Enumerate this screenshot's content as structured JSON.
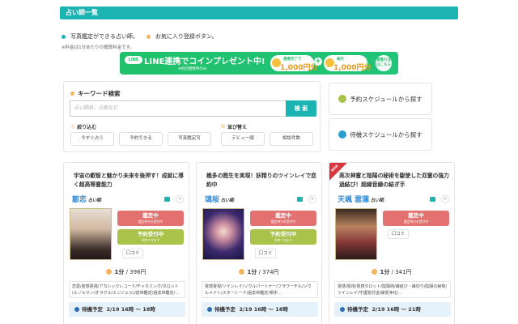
{
  "page": {
    "title": "占い師一覧"
  },
  "legend": {
    "photo_text": "写真鑑定ができる占い師。",
    "fav_text": "お気に入り登録ボタン。",
    "note": "※料金は1分あたりの概算料金です。",
    "colors": {
      "photo_dot": "#1cb3b3",
      "fav_dot": "#f4b35d"
    }
  },
  "line_banner": {
    "badge": "LINE",
    "main": "LINE連携でコインプレゼント中!",
    "sub": "※初回連携時のみ",
    "coin1_label": "連携完了で",
    "coin1_value": "1,000円分",
    "plus": "+",
    "coin2_label": "毎月",
    "coin2_value": "1,000円分",
    "detail": "連携方法はこちら"
  },
  "search": {
    "keyword_label": "キーワード検索",
    "placeholder": "占い師名、占術など",
    "button": "検 索",
    "filter_label": "絞り込む",
    "sort_label": "並び替え",
    "chips": [
      "今すぐ占う",
      "予約できる",
      "写真鑑定可",
      "デビュー順",
      "相談件数"
    ]
  },
  "schedule": {
    "reserve": "予約スケジュールから探す",
    "wait": "待機スケジュールから探す"
  },
  "cards": [
    {
      "tagline": "宇宙の叡智と魅かり未来を後押す！成就に導く超高等霊能力",
      "name": "鄒恋",
      "role": "占い師",
      "status_main": "鑑定中",
      "status_sub": "鑑定待ちを受付中",
      "reserve_main": "予約受付中",
      "reserve_sub": "予約できます",
      "kuchikomi": "口コミ",
      "price_unit": "1分",
      "price_value": "396円",
      "tags": "恋愛/霊感霊視/アカシックレコード/チャネリング/タロット(ルノルマン/オラクル/エンジェル)/前世鑑定/過去世鑑定/…",
      "wait_label": "待機予定",
      "wait_time": "2/19 16時 ～ 18時"
    },
    {
      "tagline": "幾多の甦生を実現！妖精りのツインレイで恋約中",
      "name": "璃桜",
      "role": "占い師",
      "status_main": "鑑定中",
      "status_sub": "鑑定待ちを受付中",
      "reserve_main": "予約受付中",
      "reserve_sub": "予約できます",
      "kuchikomi": "口コミ",
      "price_unit": "1分",
      "price_value": "374円",
      "tags": "霊感霊視/ツインレイ/ソウルパートナー/フラワーチル/ソウルメイト/スターシード/過去世鑑定/相手…",
      "wait_label": "待機予定",
      "wait_time": "2/19 16時 ～ 18時"
    },
    {
      "tagline": "高次神霊と陰陽の秘術を駆使した双霊の強力過結び！超縁音縁の結ぎ手",
      "name": "天颯 雲蓮",
      "role": "占い師",
      "badge": "NEW",
      "status_main": "鑑定中",
      "status_sub": "鑑定待ちを受付中",
      "kuchikomi": "口コミ",
      "price_unit": "1分",
      "price_value": "341円",
      "tags": "霊感/霊視/霊感タロット/陰陽術/縁結び・縁切り/陰陽の秘術/ツインレイ/守護霊対話/縁霊浄化/…",
      "wait_label": "待機予定",
      "wait_time": "2/19 16時 ～ 21時"
    }
  ]
}
